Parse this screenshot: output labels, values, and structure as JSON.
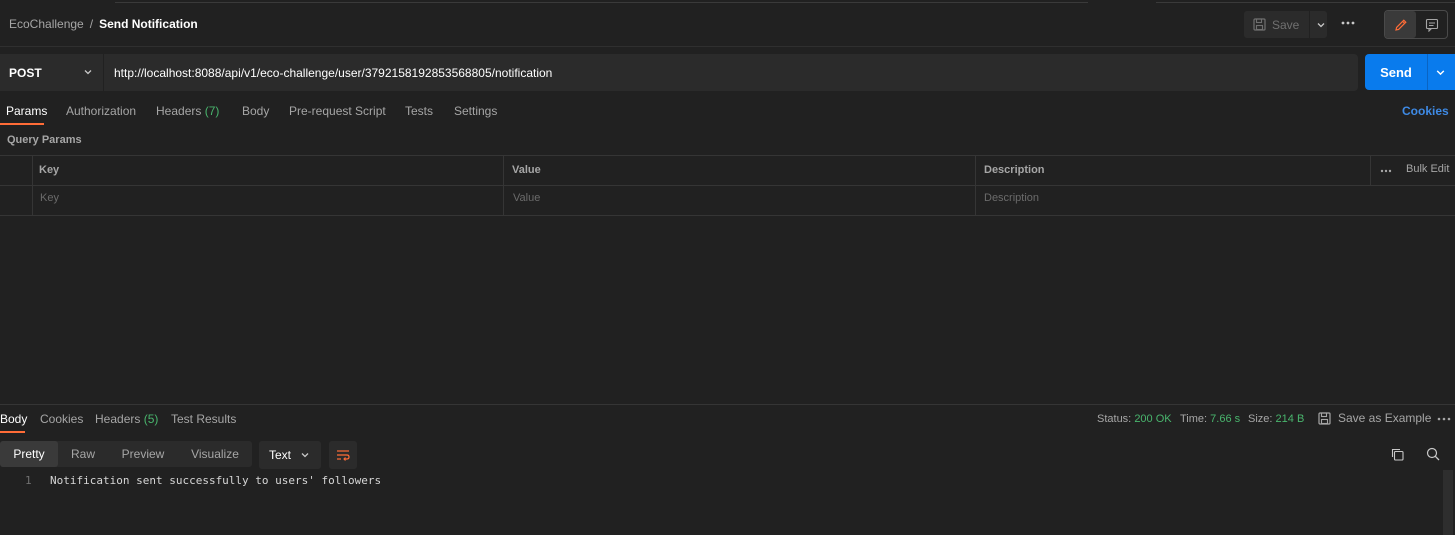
{
  "breadcrumb": {
    "collection": "EcoChallenge",
    "separator": "/",
    "request": "Send Notification"
  },
  "toolbar": {
    "save_label": "Save",
    "more_icon": "ellipsis-icon",
    "edit_icon": "pencil-icon",
    "docs_icon": "comment-icon"
  },
  "request": {
    "method": "POST",
    "url": "http://localhost:8088/api/v1/eco-challenge/user/3792158192853568805/notification",
    "send_label": "Send"
  },
  "request_tabs": [
    {
      "label": "Params",
      "count": ""
    },
    {
      "label": "Authorization",
      "count": ""
    },
    {
      "label": "Headers",
      "count": "(7)"
    },
    {
      "label": "Body",
      "count": ""
    },
    {
      "label": "Pre-request Script",
      "count": ""
    },
    {
      "label": "Tests",
      "count": ""
    },
    {
      "label": "Settings",
      "count": ""
    }
  ],
  "cookies_link": "Cookies",
  "query_params": {
    "title": "Query Params",
    "columns": [
      "Key",
      "Value",
      "Description"
    ],
    "bulk_edit": "Bulk Edit",
    "placeholders": {
      "key": "Key",
      "value": "Value",
      "description": "Description"
    }
  },
  "response": {
    "tabs": [
      {
        "label": "Body",
        "count": ""
      },
      {
        "label": "Cookies",
        "count": ""
      },
      {
        "label": "Headers",
        "count": "(5)"
      },
      {
        "label": "Test Results",
        "count": ""
      }
    ],
    "status_label": "Status:",
    "status_value": "200 OK",
    "time_label": "Time:",
    "time_value": "7.66 s",
    "size_label": "Size:",
    "size_value": "214 B",
    "save_example": "Save as Example",
    "formats": [
      "Pretty",
      "Raw",
      "Preview",
      "Visualize"
    ],
    "language": "Text",
    "lines": [
      {
        "num": "1",
        "text": "Notification sent successfully to users' followers"
      }
    ]
  },
  "colors": {
    "accent": "#ff6c37",
    "send": "#097bed",
    "success": "#49b56d",
    "link": "#3e8ae5"
  }
}
